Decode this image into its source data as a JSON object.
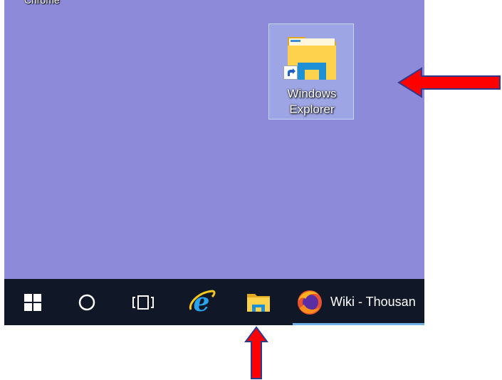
{
  "desktop": {
    "background": "#8d8bd9",
    "partial_icon_label": "Chrome",
    "icon": {
      "label_line1": "Windows",
      "label_line2": "Explorer",
      "icon_name": "folder-icon",
      "overlay": "shortcut-arrow-icon"
    }
  },
  "taskbar": {
    "background": "#101727",
    "items": [
      {
        "name": "start-button",
        "icon": "windows-logo-icon"
      },
      {
        "name": "search-button",
        "icon": "cortana-circle-icon"
      },
      {
        "name": "task-view-button",
        "icon": "task-view-icon"
      },
      {
        "name": "internet-explorer-button",
        "icon": "internet-explorer-icon"
      },
      {
        "name": "file-explorer-button",
        "icon": "folder-icon"
      },
      {
        "name": "firefox-window-button",
        "icon": "firefox-icon",
        "label": "Wiki - Thousan"
      }
    ],
    "active_indicator_color": "#6fb1e6"
  },
  "annotations": {
    "arrow_color": "#ff0000",
    "arrow_outline": "#2f3a8f"
  }
}
